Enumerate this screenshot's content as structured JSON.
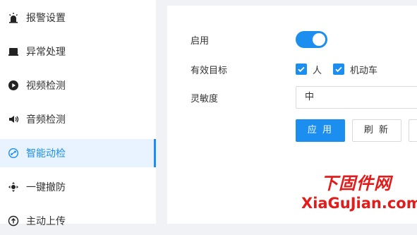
{
  "sidebar": {
    "items": [
      {
        "label": "报警设置",
        "icon": "alarm-light-icon"
      },
      {
        "label": "异常处理",
        "icon": "monitor-icon"
      },
      {
        "label": "视频检测",
        "icon": "play-circle-icon"
      },
      {
        "label": "音频检测",
        "icon": "speaker-icon"
      },
      {
        "label": "智能动检",
        "icon": "smart-motion-icon"
      },
      {
        "label": "一键撤防",
        "icon": "disarm-icon"
      },
      {
        "label": "主动上传",
        "icon": "upload-icon"
      }
    ],
    "active_index": 4
  },
  "form": {
    "enable_label": "启用",
    "enable_on": true,
    "target_label": "有效目标",
    "targets": [
      {
        "label": "人",
        "checked": true
      },
      {
        "label": "机动车",
        "checked": true
      }
    ],
    "sensitivity_label": "灵敏度",
    "sensitivity_value": "中"
  },
  "buttons": {
    "apply": "应 用",
    "refresh": "刷 新"
  },
  "watermark": {
    "cn": "下固件网",
    "en": "XiaGuJian.com"
  },
  "colors": {
    "accent": "#1b8ef0",
    "watermark": "#e21b1b"
  }
}
